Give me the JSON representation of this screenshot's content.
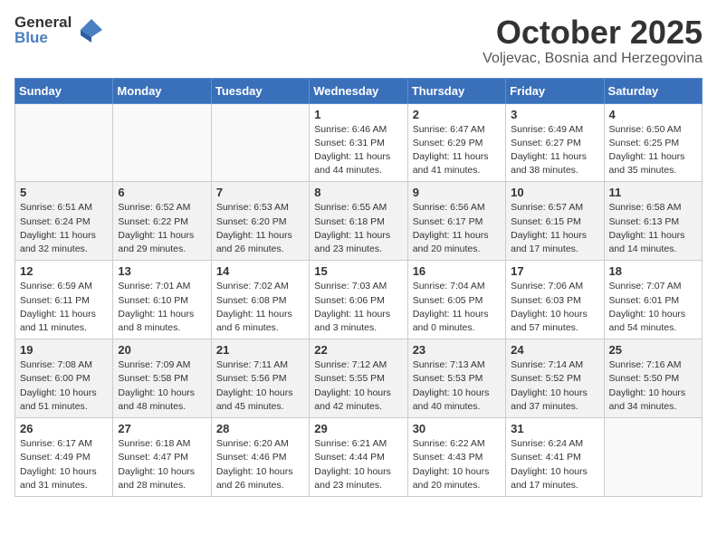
{
  "header": {
    "logo_general": "General",
    "logo_blue": "Blue",
    "month": "October 2025",
    "location": "Voljevac, Bosnia and Herzegovina"
  },
  "weekdays": [
    "Sunday",
    "Monday",
    "Tuesday",
    "Wednesday",
    "Thursday",
    "Friday",
    "Saturday"
  ],
  "weeks": [
    [
      {
        "day": "",
        "info": ""
      },
      {
        "day": "",
        "info": ""
      },
      {
        "day": "",
        "info": ""
      },
      {
        "day": "1",
        "info": "Sunrise: 6:46 AM\nSunset: 6:31 PM\nDaylight: 11 hours\nand 44 minutes."
      },
      {
        "day": "2",
        "info": "Sunrise: 6:47 AM\nSunset: 6:29 PM\nDaylight: 11 hours\nand 41 minutes."
      },
      {
        "day": "3",
        "info": "Sunrise: 6:49 AM\nSunset: 6:27 PM\nDaylight: 11 hours\nand 38 minutes."
      },
      {
        "day": "4",
        "info": "Sunrise: 6:50 AM\nSunset: 6:25 PM\nDaylight: 11 hours\nand 35 minutes."
      }
    ],
    [
      {
        "day": "5",
        "info": "Sunrise: 6:51 AM\nSunset: 6:24 PM\nDaylight: 11 hours\nand 32 minutes."
      },
      {
        "day": "6",
        "info": "Sunrise: 6:52 AM\nSunset: 6:22 PM\nDaylight: 11 hours\nand 29 minutes."
      },
      {
        "day": "7",
        "info": "Sunrise: 6:53 AM\nSunset: 6:20 PM\nDaylight: 11 hours\nand 26 minutes."
      },
      {
        "day": "8",
        "info": "Sunrise: 6:55 AM\nSunset: 6:18 PM\nDaylight: 11 hours\nand 23 minutes."
      },
      {
        "day": "9",
        "info": "Sunrise: 6:56 AM\nSunset: 6:17 PM\nDaylight: 11 hours\nand 20 minutes."
      },
      {
        "day": "10",
        "info": "Sunrise: 6:57 AM\nSunset: 6:15 PM\nDaylight: 11 hours\nand 17 minutes."
      },
      {
        "day": "11",
        "info": "Sunrise: 6:58 AM\nSunset: 6:13 PM\nDaylight: 11 hours\nand 14 minutes."
      }
    ],
    [
      {
        "day": "12",
        "info": "Sunrise: 6:59 AM\nSunset: 6:11 PM\nDaylight: 11 hours\nand 11 minutes."
      },
      {
        "day": "13",
        "info": "Sunrise: 7:01 AM\nSunset: 6:10 PM\nDaylight: 11 hours\nand 8 minutes."
      },
      {
        "day": "14",
        "info": "Sunrise: 7:02 AM\nSunset: 6:08 PM\nDaylight: 11 hours\nand 6 minutes."
      },
      {
        "day": "15",
        "info": "Sunrise: 7:03 AM\nSunset: 6:06 PM\nDaylight: 11 hours\nand 3 minutes."
      },
      {
        "day": "16",
        "info": "Sunrise: 7:04 AM\nSunset: 6:05 PM\nDaylight: 11 hours\nand 0 minutes."
      },
      {
        "day": "17",
        "info": "Sunrise: 7:06 AM\nSunset: 6:03 PM\nDaylight: 10 hours\nand 57 minutes."
      },
      {
        "day": "18",
        "info": "Sunrise: 7:07 AM\nSunset: 6:01 PM\nDaylight: 10 hours\nand 54 minutes."
      }
    ],
    [
      {
        "day": "19",
        "info": "Sunrise: 7:08 AM\nSunset: 6:00 PM\nDaylight: 10 hours\nand 51 minutes."
      },
      {
        "day": "20",
        "info": "Sunrise: 7:09 AM\nSunset: 5:58 PM\nDaylight: 10 hours\nand 48 minutes."
      },
      {
        "day": "21",
        "info": "Sunrise: 7:11 AM\nSunset: 5:56 PM\nDaylight: 10 hours\nand 45 minutes."
      },
      {
        "day": "22",
        "info": "Sunrise: 7:12 AM\nSunset: 5:55 PM\nDaylight: 10 hours\nand 42 minutes."
      },
      {
        "day": "23",
        "info": "Sunrise: 7:13 AM\nSunset: 5:53 PM\nDaylight: 10 hours\nand 40 minutes."
      },
      {
        "day": "24",
        "info": "Sunrise: 7:14 AM\nSunset: 5:52 PM\nDaylight: 10 hours\nand 37 minutes."
      },
      {
        "day": "25",
        "info": "Sunrise: 7:16 AM\nSunset: 5:50 PM\nDaylight: 10 hours\nand 34 minutes."
      }
    ],
    [
      {
        "day": "26",
        "info": "Sunrise: 6:17 AM\nSunset: 4:49 PM\nDaylight: 10 hours\nand 31 minutes."
      },
      {
        "day": "27",
        "info": "Sunrise: 6:18 AM\nSunset: 4:47 PM\nDaylight: 10 hours\nand 28 minutes."
      },
      {
        "day": "28",
        "info": "Sunrise: 6:20 AM\nSunset: 4:46 PM\nDaylight: 10 hours\nand 26 minutes."
      },
      {
        "day": "29",
        "info": "Sunrise: 6:21 AM\nSunset: 4:44 PM\nDaylight: 10 hours\nand 23 minutes."
      },
      {
        "day": "30",
        "info": "Sunrise: 6:22 AM\nSunset: 4:43 PM\nDaylight: 10 hours\nand 20 minutes."
      },
      {
        "day": "31",
        "info": "Sunrise: 6:24 AM\nSunset: 4:41 PM\nDaylight: 10 hours\nand 17 minutes."
      },
      {
        "day": "",
        "info": ""
      }
    ]
  ]
}
